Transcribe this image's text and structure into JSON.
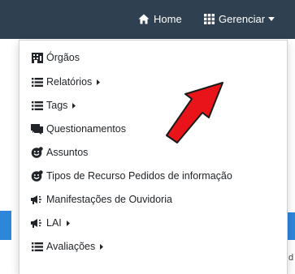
{
  "navbar": {
    "home_label": "Home",
    "manage_label": "Gerenciar"
  },
  "menu": {
    "items": [
      {
        "label": "Órgãos",
        "icon": "building-icon"
      },
      {
        "label": "Relatórios",
        "icon": "list-icon",
        "submenu": true
      },
      {
        "label": "Tags",
        "icon": "list-icon",
        "submenu": true
      },
      {
        "label": "Questionamentos",
        "icon": "chat-bubbles-icon"
      },
      {
        "label": "Assuntos",
        "icon": "smiley-badge-icon"
      },
      {
        "label": "Tipos de Recurso Pedidos de informação",
        "icon": "smiley-badge-icon"
      },
      {
        "label": "Manifestações de Ouvidoria",
        "icon": "megaphone-icon"
      },
      {
        "label": "LAI",
        "icon": "megaphone-icon",
        "submenu": true
      },
      {
        "label": "Avaliações",
        "icon": "list-icon",
        "submenu": true
      }
    ]
  },
  "background": {
    "partial_letter": "d"
  },
  "annotation": {
    "arrow_color": "#e8141a"
  },
  "colors": {
    "navbar": "#2f4150",
    "accent": "#2e86d9"
  }
}
